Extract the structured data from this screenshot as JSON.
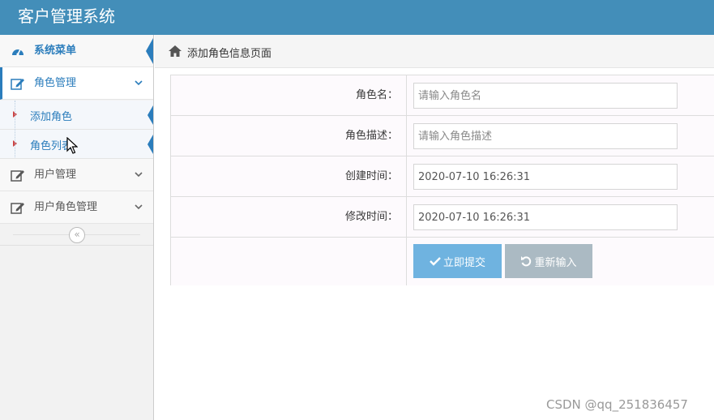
{
  "app": {
    "title": "客户管理系统"
  },
  "sidebar": {
    "header": {
      "label": "系统菜单",
      "icon": "dashboard-icon"
    },
    "items": [
      {
        "label": "角色管理",
        "icon": "edit-icon",
        "expanded": true
      },
      {
        "label": "用户管理",
        "icon": "edit-icon",
        "expanded": false
      },
      {
        "label": "用户角色管理",
        "icon": "edit-icon",
        "expanded": false
      }
    ],
    "submenu": [
      {
        "label": "添加角色"
      },
      {
        "label": "角色列表"
      }
    ],
    "collapse_icon": "double-chevron-left-icon"
  },
  "breadcrumb": {
    "icon": "home-icon",
    "text": "添加角色信息页面"
  },
  "form": {
    "fields": [
      {
        "label": "角色名：",
        "value": "",
        "placeholder": "请输入角色名"
      },
      {
        "label": "角色描述：",
        "value": "",
        "placeholder": "请输入角色描述"
      },
      {
        "label": "创建时间：",
        "value": "2020-07-10 16:26:31",
        "placeholder": ""
      },
      {
        "label": "修改时间：",
        "value": "2020-07-10 16:26:31",
        "placeholder": ""
      }
    ],
    "submit_label": "立即提交",
    "reset_label": "重新输入"
  },
  "watermark": "CSDN @qq_251836457",
  "colors": {
    "topbar": "#438eb9",
    "accent": "#2b7dbc",
    "submit": "#6fb3e0",
    "reset": "#abbac3"
  }
}
